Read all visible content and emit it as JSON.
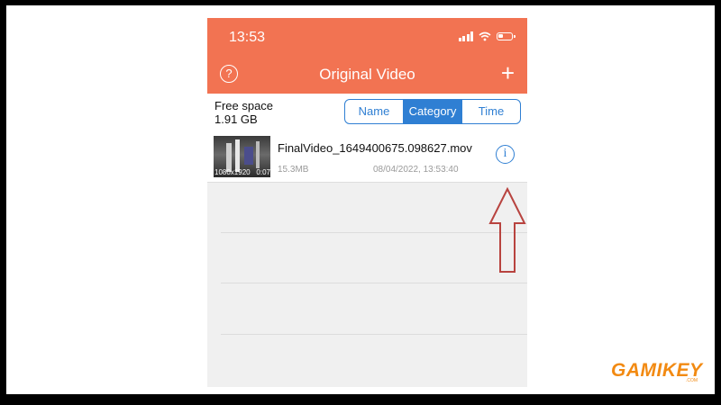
{
  "status_bar": {
    "time": "13:53"
  },
  "header": {
    "title": "Original Video",
    "help_icon": "question-circle-icon",
    "add_icon": "plus-icon",
    "add_symbol": "+",
    "help_symbol": "?"
  },
  "storage": {
    "label": "Free space",
    "value": "1.91 GB"
  },
  "sort_tabs": [
    {
      "label": "Name",
      "active": false
    },
    {
      "label": "Category",
      "active": true
    },
    {
      "label": "Time",
      "active": false
    }
  ],
  "videos": [
    {
      "filename": "FinalVideo_1649400675.098627.mov",
      "size": "15.3MB",
      "date": "08/04/2022, 13:53:40",
      "resolution": "1080x1920",
      "duration": "0:07",
      "info_symbol": "i"
    }
  ],
  "watermark": {
    "brand": "GAMIKEY",
    "suffix": ".COM"
  },
  "colors": {
    "header": "#f27352",
    "accent": "#2f7fd3",
    "annotation_arrow": "#b8433f",
    "watermark": "#f28a12"
  }
}
